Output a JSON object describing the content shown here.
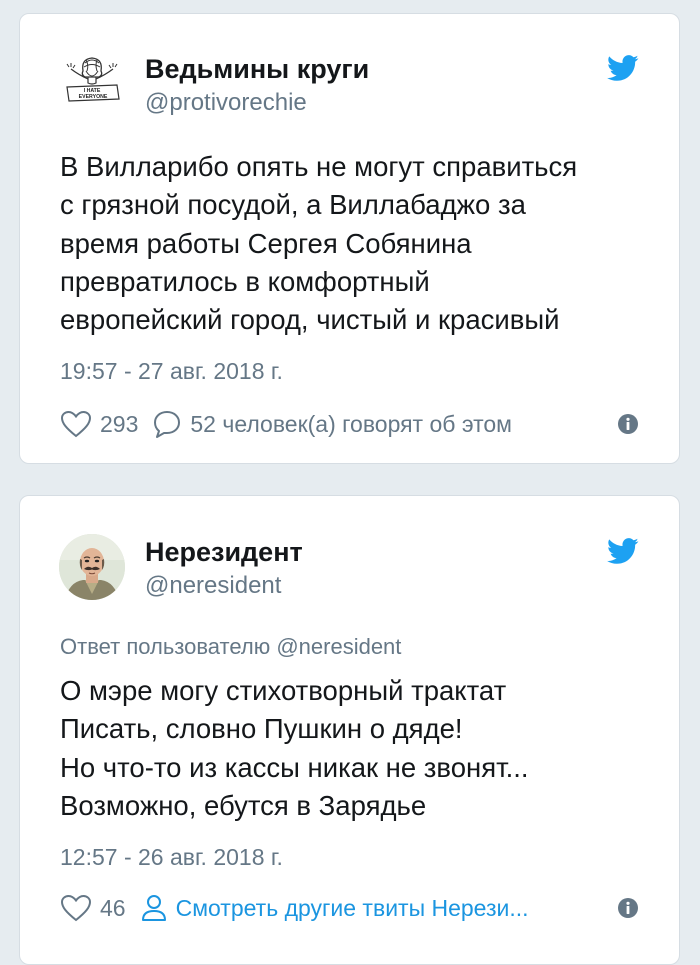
{
  "tweets": [
    {
      "author_name": "Ведьмины круги",
      "author_handle": "@protivorechie",
      "avatar_text": [
        "I HATE",
        "EVERYONE"
      ],
      "text_lines": [
        "В Вилларибо опять не могут справиться",
        "с грязной посудой, а Виллабаджо за",
        "время работы Сергея Собянина",
        "превратилось в комфортный",
        "европейский город, чистый и красивый"
      ],
      "timestamp": "19:57 - 27 авг. 2018 г.",
      "likes": "293",
      "replies_label": "52 человек(а) говорят об этом",
      "icons": {
        "like": "heart-icon",
        "reply": "speech-bubble-icon",
        "info": "info-icon",
        "brand": "twitter-bird-icon"
      }
    },
    {
      "author_name": "Нерезидент",
      "author_handle": "@neresident",
      "reply_to": "Ответ пользователю @neresident",
      "text_lines": [
        "О мэре могу стихотворный трактат",
        "Писать, словно Пушкин о дяде!",
        "Но что-то из кассы никак не звонят...",
        "Возможно, ебутся в Зарядье"
      ],
      "timestamp": "12:57 - 26 авг. 2018 г.",
      "likes": "46",
      "more_tweets_label": "Смотреть другие твиты Нерези...",
      "icons": {
        "like": "heart-icon",
        "profile": "person-icon",
        "info": "info-icon",
        "brand": "twitter-bird-icon"
      }
    }
  ],
  "colors": {
    "background": "#e6ecf0",
    "card": "#ffffff",
    "text": "#14171a",
    "secondary": "#657786",
    "twitter_blue": "#1da1f2",
    "link": "#1b95e0"
  }
}
